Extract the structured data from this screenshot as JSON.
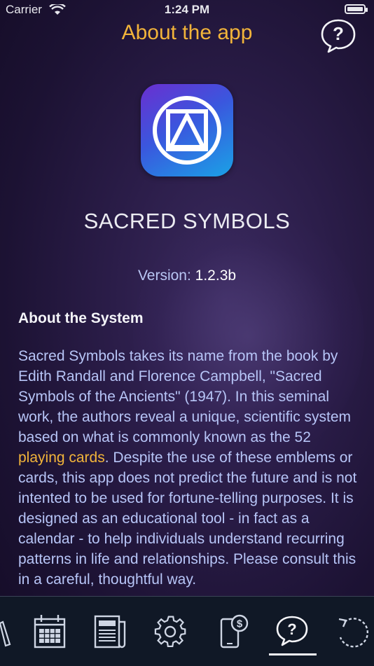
{
  "status_bar": {
    "carrier": "Carrier",
    "time": "1:24 PM"
  },
  "nav": {
    "title": "About the app",
    "help_icon": "question-bubble-icon"
  },
  "app": {
    "name": "SACRED SYMBOLS",
    "version_label": "Version:",
    "version_value": "1.2.3b"
  },
  "section": {
    "title": "About the System"
  },
  "body": {
    "part1": "Sacred Symbols takes its name from the book by Edith Randall and Florence Campbell, \"Sacred Symbols of the Ancients\" (1947). In this seminal work, the authors reveal a unique, scientific system based on what is commonly known as the 52 ",
    "highlight": "playing cards",
    "part2": ". Despite the use of these emblems or cards, this app does not predict the future and is not intented to be used for fortune-telling purposes. It is designed as an educational tool - in fact as a calendar - to help individuals understand recurring patterns in life and relationships. Please consult this in a careful, thoughtful way."
  },
  "colors": {
    "accent": "#f2b43a",
    "body_text": "#b7c5f7",
    "tab_bar": "#101826"
  },
  "tabs": [
    {
      "icon": "partial-icon"
    },
    {
      "icon": "calendar-icon"
    },
    {
      "icon": "newspaper-icon"
    },
    {
      "icon": "gear-icon"
    },
    {
      "icon": "phone-dollar-icon"
    },
    {
      "icon": "question-bubble-icon",
      "selected": true
    },
    {
      "icon": "refresh-icon"
    }
  ]
}
